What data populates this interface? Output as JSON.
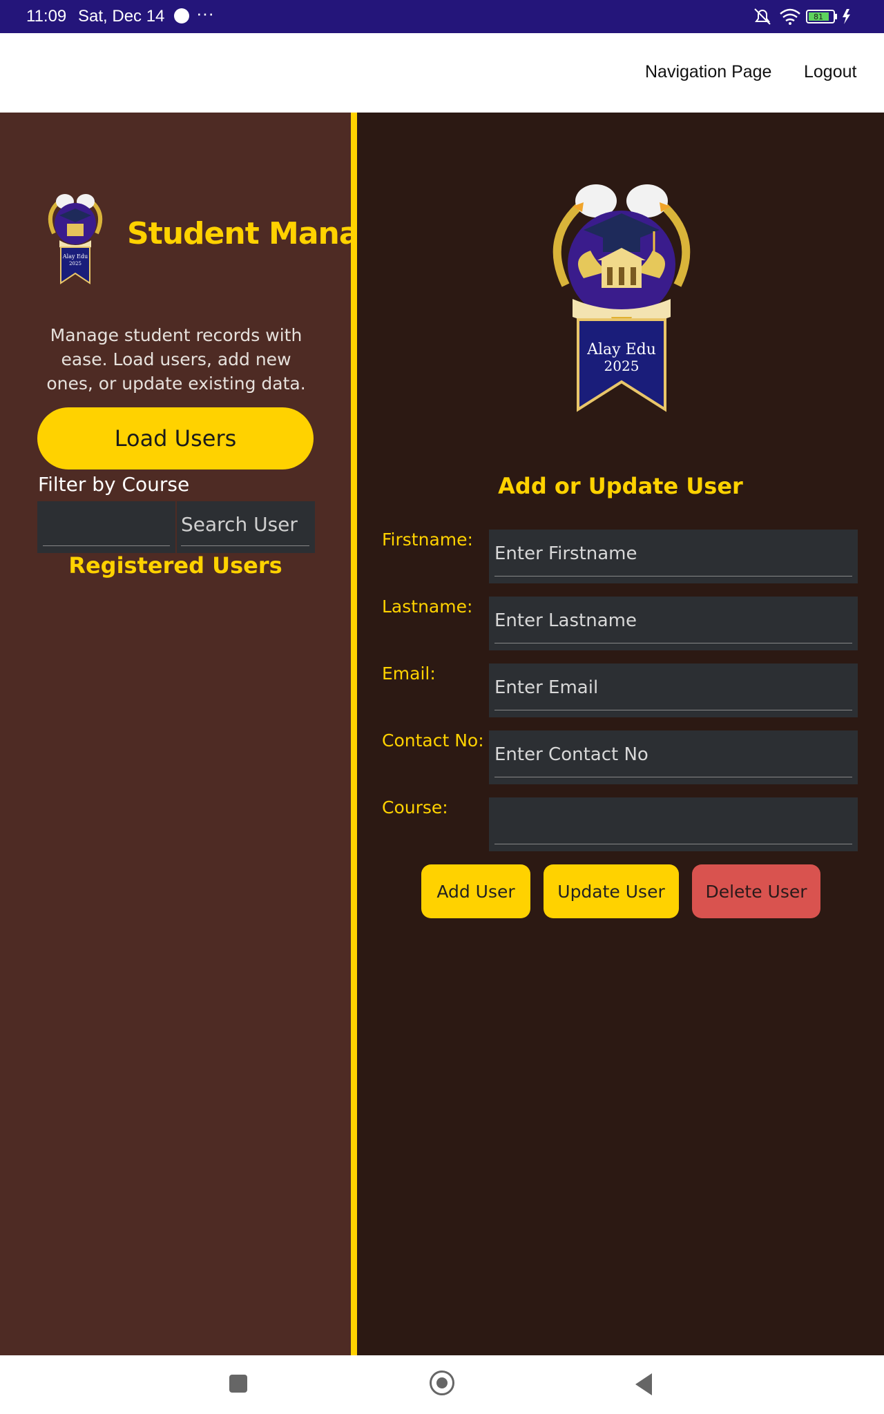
{
  "status_bar": {
    "time": "11:09",
    "date": "Sat, Dec 14",
    "more": "···",
    "battery": "81",
    "icons": [
      "messenger-icon",
      "mute-icon",
      "wifi-icon",
      "battery-icon",
      "charging-icon"
    ]
  },
  "nav": {
    "navigation_link": "Navigation Page",
    "logout_link": "Logout"
  },
  "sidebar": {
    "logo_text_line1": "Alay Edu",
    "logo_text_line2": "2025",
    "title": "Student Management",
    "description": "Manage student records with ease. Load users, add new ones, or update existing data.",
    "load_button": "Load Users",
    "filter_label": "Filter by Course",
    "filter_value": "",
    "search_placeholder": "Search User",
    "registered_title": "Registered Users"
  },
  "form": {
    "logo_text_line1": "Alay Edu",
    "logo_text_line2": "2025",
    "title": "Add or Update User",
    "fields": [
      {
        "label": "Firstname:",
        "placeholder": "Enter Firstname"
      },
      {
        "label": "Lastname:",
        "placeholder": "Enter Lastname"
      },
      {
        "label": "Email:",
        "placeholder": "Enter Email"
      },
      {
        "label": "Contact No:",
        "placeholder": "Enter Contact No"
      },
      {
        "label": "Course:",
        "placeholder": ""
      }
    ],
    "buttons": {
      "add": "Add User",
      "update": "Update User",
      "delete": "Delete User"
    }
  },
  "colors": {
    "accent": "#ffd200",
    "status_bar": "#24157a",
    "left_panel": "#4e2b24",
    "right_panel": "#2c1913",
    "input_bg": "#2c2f33",
    "danger": "#d9534f"
  }
}
